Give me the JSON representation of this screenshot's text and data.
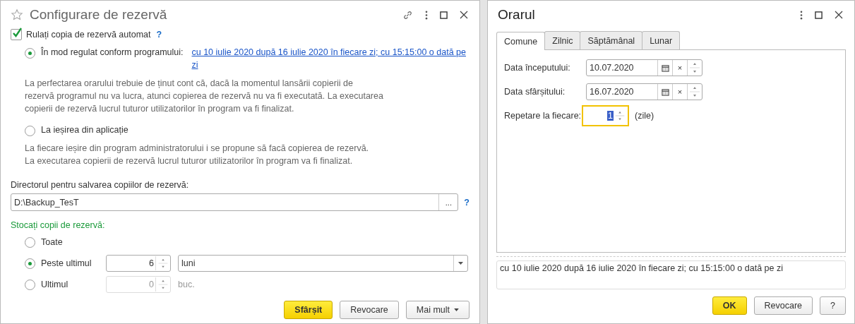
{
  "left_window": {
    "title": "Configurare de rezervă"
  },
  "auto_backup": {
    "label": "Rulați copia de rezervă automat",
    "checked": true,
    "help": "?"
  },
  "run_modes": [
    {
      "label": "În mod regulat conform programului:",
      "selected": true,
      "link": "cu 10 iulie 2020 după 16 iulie 2020 în fiecare zi; cu 15:15:00 o dată pe zi",
      "note_lines": [
        "La perfectarea orarului trebuie de ținut cont că, dacă la momentul lansării copierii de",
        "rezervă programul nu va lucra, atunci copierea de rezervă nu va fi executată. La executarea",
        "copierii de rezervă lucrul tuturor utilizatorilor în program va fi finalizat."
      ]
    },
    {
      "label": "La ieșirea din aplicație",
      "selected": false,
      "note_lines": [
        "La fiecare ieșire din program administratorului i se propune să facă copierea de rezervă.",
        "La executarea copierii de rezervă lucrul tuturor utilizatorilor în program va fi finalizat."
      ]
    }
  ],
  "directory": {
    "label": "Directorul pentru salvarea copiilor de rezervă:",
    "value": "D:\\Backup_TesT",
    "browse": "...",
    "help": "?"
  },
  "storage": {
    "label": "Stocați copii de rezervă:",
    "options": [
      {
        "kind": "plain",
        "label": "Toate",
        "selected": false
      },
      {
        "kind": "period",
        "label": "Peste ultimul",
        "selected": true,
        "value": "6",
        "unit": "luni",
        "disabled": false
      },
      {
        "kind": "count",
        "label": "Ultimul",
        "selected": false,
        "value": "0",
        "unit": "buc.",
        "disabled": true
      }
    ]
  },
  "left_buttons": [
    {
      "label": "Sfârșit",
      "kind": "primary"
    },
    {
      "label": "Revocare",
      "kind": "plain"
    },
    {
      "label": "Mai mult",
      "kind": "menu"
    }
  ],
  "right_window": {
    "title": "Orarul"
  },
  "tabs": [
    {
      "label": "Comune",
      "selected": true
    },
    {
      "label": "Zilnic",
      "selected": false
    },
    {
      "label": "Săptămânal",
      "selected": false
    },
    {
      "label": "Lunar",
      "selected": false
    }
  ],
  "fields": [
    {
      "kind": "date",
      "label": "Data începutului:",
      "value": "10.07.2020",
      "clear": "×"
    },
    {
      "kind": "date",
      "label": "Data sfârșitului:",
      "value": "16.07.2020",
      "clear": "×"
    },
    {
      "kind": "number",
      "label": "Repetare la fiecare:",
      "value": "1",
      "unit": "(zile)",
      "focused": true
    }
  ],
  "summary": "cu 10 iulie 2020 după 16 iulie 2020 în fiecare zi; cu 15:15:00 o dată pe zi",
  "right_buttons": [
    {
      "label": "OK",
      "kind": "primary"
    },
    {
      "label": "Revocare",
      "kind": "plain"
    },
    {
      "label": "?",
      "kind": "plain"
    }
  ]
}
